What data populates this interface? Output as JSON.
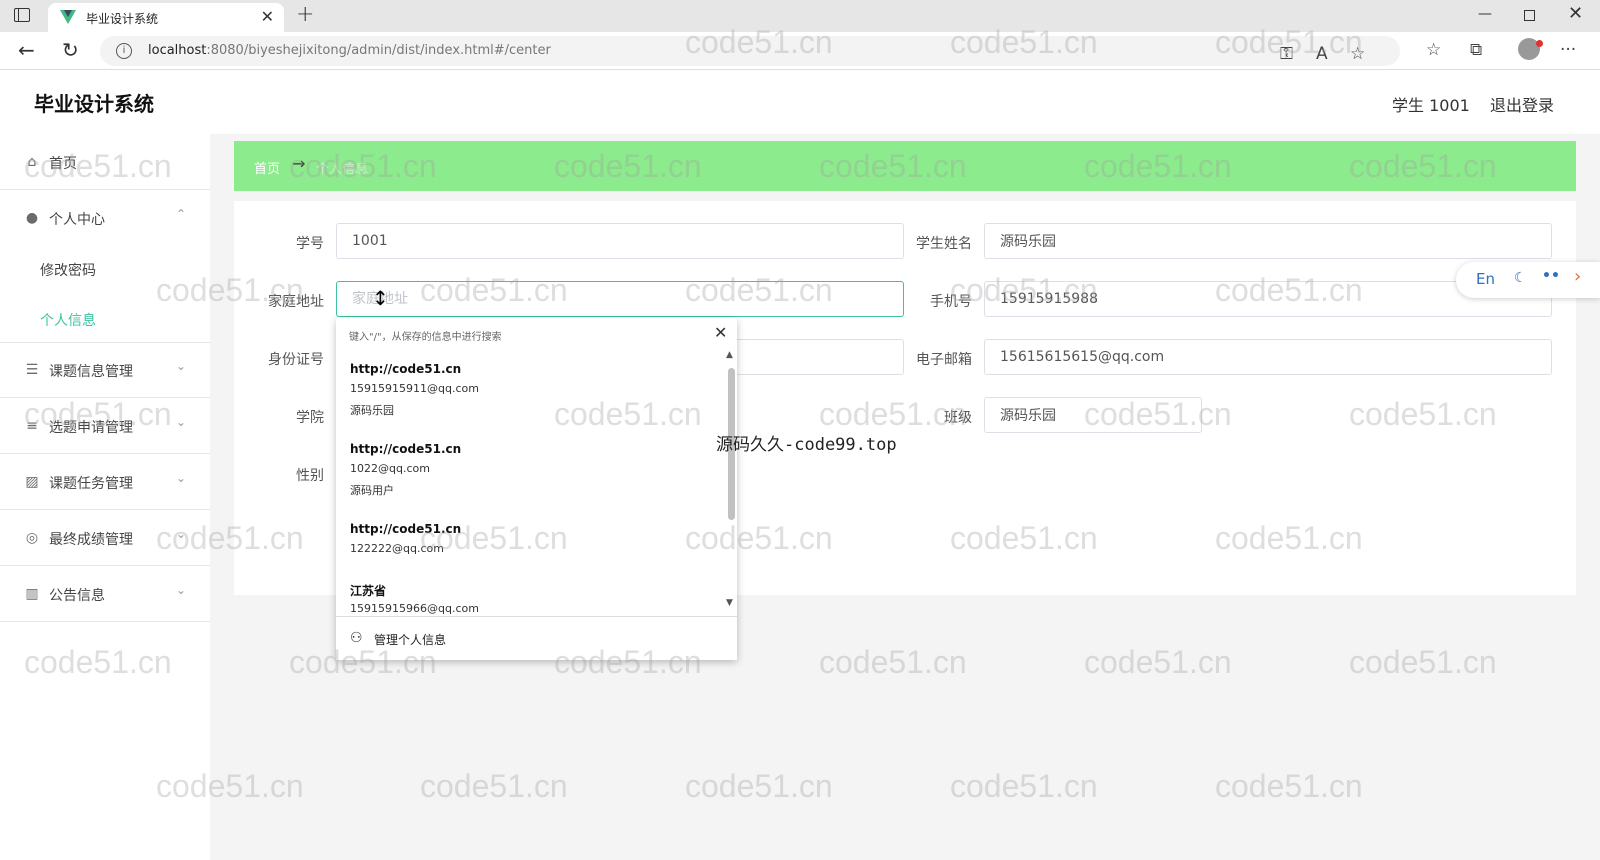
{
  "browser": {
    "tab_title": "毕业设计系统",
    "url_host": "localhost",
    "url_rest": ":8080/biyeshejixitong/admin/dist/index.html#/center",
    "new_tab": "+",
    "close_tab": "✕"
  },
  "header": {
    "title": "毕业设计系统",
    "user": "学生 1001",
    "logout": "退出登录"
  },
  "sidebar": {
    "items": [
      {
        "label": "首页",
        "icon": "home-icon",
        "arrow": ""
      },
      {
        "label": "个人中心",
        "icon": "user-icon",
        "arrow": "⌃"
      },
      {
        "label": "课题信息管理",
        "icon": "sliders-icon",
        "arrow": "⌄"
      },
      {
        "label": "选题申请管理",
        "icon": "list-icon",
        "arrow": "⌄"
      },
      {
        "label": "课题任务管理",
        "icon": "chart-icon",
        "arrow": "⌄"
      },
      {
        "label": "最终成绩管理",
        "icon": "target-icon",
        "arrow": "⌄"
      },
      {
        "label": "公告信息",
        "icon": "library-icon",
        "arrow": "⌄"
      }
    ],
    "submenu": [
      {
        "label": "修改密码",
        "active": false
      },
      {
        "label": "个人信息",
        "active": true
      }
    ]
  },
  "breadcrumb": {
    "home": "首页",
    "separator": "→",
    "current": "个人信息"
  },
  "form": {
    "student_id_label": "学号",
    "student_id_value": "1001",
    "student_name_label": "学生姓名",
    "student_name_value": "源码乐园",
    "address_label": "家庭地址",
    "address_placeholder": "家庭地址",
    "phone_label": "手机号",
    "phone_value": "15915915988",
    "idcard_label": "身份证号",
    "email_label": "电子邮箱",
    "email_value": "15615615615@qq.com",
    "college_label": "学院",
    "class_label": "班级",
    "class_value": "源码乐园",
    "gender_label": "性别"
  },
  "autofill": {
    "hint": "键入\"/\"，从保存的信息中进行搜索",
    "entries": [
      {
        "line1": "http://code51.cn",
        "line2": "15915915911@qq.com",
        "line3": "源码乐园"
      },
      {
        "line1": "http://code51.cn",
        "line2": "1022@qq.com",
        "line3": "源码用户"
      },
      {
        "line1": "http://code51.cn",
        "line2": "122222@qq.com",
        "line3": ""
      },
      {
        "line1": "江苏省",
        "line2": "15915915966@qq.com",
        "line3": ""
      }
    ],
    "manage": "管理个人信息"
  },
  "translate": {
    "lang": "En"
  },
  "overlay": "源码久久-code99.top",
  "watermark": "code51.cn",
  "colors": {
    "accent": "#3cc3a0",
    "breadcrumb_bg": "#8ceb8c"
  }
}
